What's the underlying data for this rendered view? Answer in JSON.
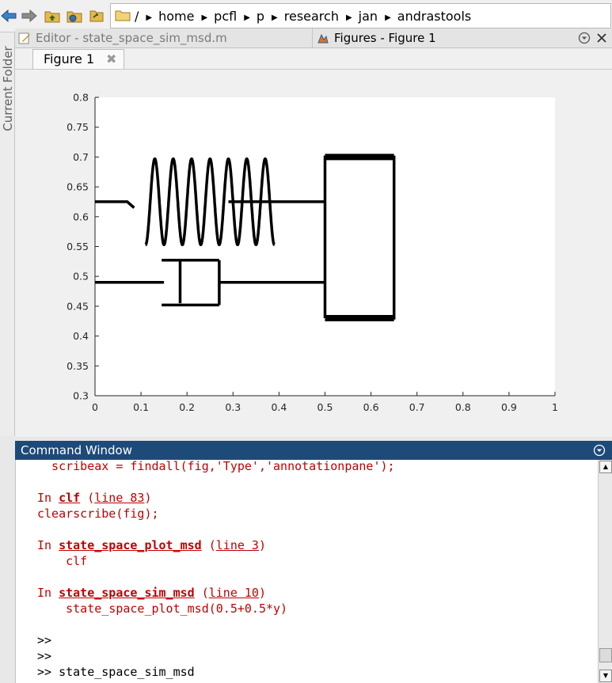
{
  "toolbar": {
    "icons": [
      "back-arrow-icon",
      "forward-arrow-icon",
      "up-folder-icon",
      "browse-folder-icon",
      "refresh-icon"
    ]
  },
  "address": {
    "root": "/",
    "crumbs": [
      "home",
      "pcfl",
      "p",
      "research",
      "jan",
      "andrastools"
    ]
  },
  "left_panel": {
    "label": "Current Folder"
  },
  "tabs": {
    "editor": "Editor - state_space_sim_msd.m",
    "figures": "Figures - Figure 1"
  },
  "figure": {
    "tab_label": "Figure 1",
    "close_glyph": "✖"
  },
  "chart_data": {
    "type": "line",
    "xlim": [
      0,
      1
    ],
    "ylim": [
      0.3,
      0.8
    ],
    "xticks": [
      "0",
      "0.1",
      "0.2",
      "0.3",
      "0.4",
      "0.5",
      "0.6",
      "0.7",
      "0.8",
      "0.9",
      "1"
    ],
    "yticks": [
      "0.3",
      "0.35",
      "0.4",
      "0.45",
      "0.5",
      "0.55",
      "0.6",
      "0.65",
      "0.7",
      "0.75",
      "0.8"
    ],
    "grid": false,
    "series": [
      {
        "values": [
          [
            0.0,
            0.625
          ],
          [
            0.07,
            0.625
          ],
          [
            0.085,
            0.615
          ]
        ]
      },
      {
        "values": [
          [
            0.29,
            0.625
          ],
          [
            0.5,
            0.625
          ]
        ]
      },
      {
        "values": [
          [
            0.0,
            0.49
          ],
          [
            0.15,
            0.49
          ]
        ]
      },
      {
        "values": [
          [
            0.145,
            0.452
          ],
          [
            0.27,
            0.452
          ]
        ]
      },
      {
        "values": [
          [
            0.145,
            0.527
          ],
          [
            0.27,
            0.527
          ]
        ]
      },
      {
        "values": [
          [
            0.185,
            0.455
          ],
          [
            0.185,
            0.525
          ]
        ]
      },
      {
        "values": [
          [
            0.27,
            0.452
          ],
          [
            0.27,
            0.527
          ]
        ]
      },
      {
        "values": [
          [
            0.27,
            0.49
          ],
          [
            0.5,
            0.49
          ]
        ]
      },
      {
        "values": [
          [
            0.5,
            0.43
          ],
          [
            0.65,
            0.43
          ],
          [
            0.65,
            0.7
          ],
          [
            0.5,
            0.7
          ],
          [
            0.5,
            0.43
          ]
        ]
      }
    ],
    "spring": {
      "turns": 7,
      "x_start": 0.11,
      "x_end": 0.39,
      "y_center": 0.625,
      "radius_y": 0.072,
      "radius_x": 0.028
    }
  },
  "command_window": {
    "title": "Command Window",
    "lines": [
      {
        "parts": [
          {
            "t": "  scribeax = findall(fig,'Type','annotationpane');",
            "c": "red"
          }
        ]
      },
      {
        "parts": []
      },
      {
        "parts": [
          {
            "t": "In ",
            "c": "red"
          },
          {
            "t": "clf",
            "c": "lnkb"
          },
          {
            "t": " (",
            "c": "red"
          },
          {
            "t": "line 83",
            "c": "lnk"
          },
          {
            "t": ")",
            "c": "red"
          }
        ]
      },
      {
        "parts": [
          {
            "t": "clearscribe(fig);",
            "c": "red"
          }
        ]
      },
      {
        "parts": []
      },
      {
        "parts": [
          {
            "t": "In ",
            "c": "red"
          },
          {
            "t": "state_space_plot_msd",
            "c": "lnkb"
          },
          {
            "t": " (",
            "c": "red"
          },
          {
            "t": "line 3",
            "c": "lnk"
          },
          {
            "t": ")",
            "c": "red"
          }
        ]
      },
      {
        "parts": [
          {
            "t": "    clf",
            "c": "red"
          }
        ]
      },
      {
        "parts": []
      },
      {
        "parts": [
          {
            "t": "In ",
            "c": "red"
          },
          {
            "t": "state_space_sim_msd",
            "c": "lnkb"
          },
          {
            "t": " (",
            "c": "red"
          },
          {
            "t": "line 10",
            "c": "lnk"
          },
          {
            "t": ")",
            "c": "red"
          }
        ]
      },
      {
        "parts": [
          {
            "t": "    state_space_plot_msd(0.5+0.5*y)",
            "c": "red"
          }
        ]
      },
      {
        "parts": []
      },
      {
        "parts": [
          {
            "t": ">>",
            "c": "k"
          }
        ]
      },
      {
        "parts": [
          {
            "t": ">>",
            "c": "k"
          }
        ]
      },
      {
        "parts": [
          {
            "t": ">> state_space_sim_msd",
            "c": "k"
          }
        ]
      }
    ]
  }
}
